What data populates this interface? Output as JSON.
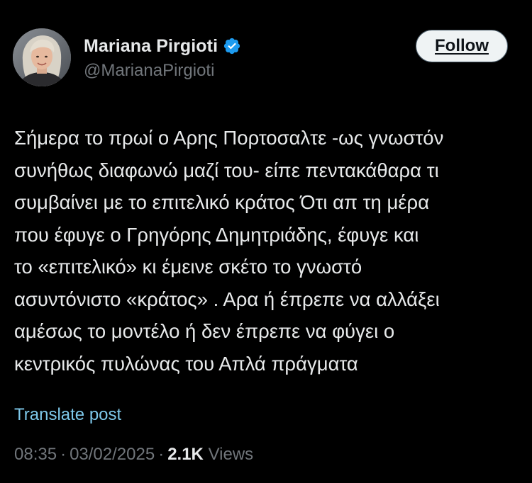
{
  "post": {
    "author": {
      "display_name": "Mariana Pirgioti",
      "handle": "@MarianaPirgioti",
      "verified_icon": "verified-badge-icon",
      "avatar_icon": "user-avatar-photo"
    },
    "follow_label": "Follow",
    "text": "Σήμερα το πρωί ο Αρης Πορτοσαλτε -ως γνωστόν\nσυνήθως διαφωνώ μαζί του- είπε πεντακάθαρα τι\nσυμβαίνει με το επιτελικό κράτος Ότι απ τη μέρα\nπου έφυγε ο Γρηγόρης Δημητριάδης, έφυγε και\nτο «επιτελικό» κι έμεινε σκέτο το γνωστό\nασυντόνιστο «κράτος» . Αρα ή έπρεπε να αλλάξει\nαμέσως το μοντέλο ή δεν έπρεπε να φύγει ο\nκεντρικός πυλώνας του Απλά πράγματα",
    "translate_label": "Translate post",
    "time": "08:35",
    "date": "03/02/2025",
    "separator": "·",
    "views_count": "2.1K",
    "views_label": "Views"
  },
  "colors": {
    "background": "#000000",
    "text": "#e7e9ea",
    "secondary": "#71767b",
    "link": "#7ec8ea",
    "verified": "#1d9bf0",
    "button_bg": "#eff3f4"
  }
}
